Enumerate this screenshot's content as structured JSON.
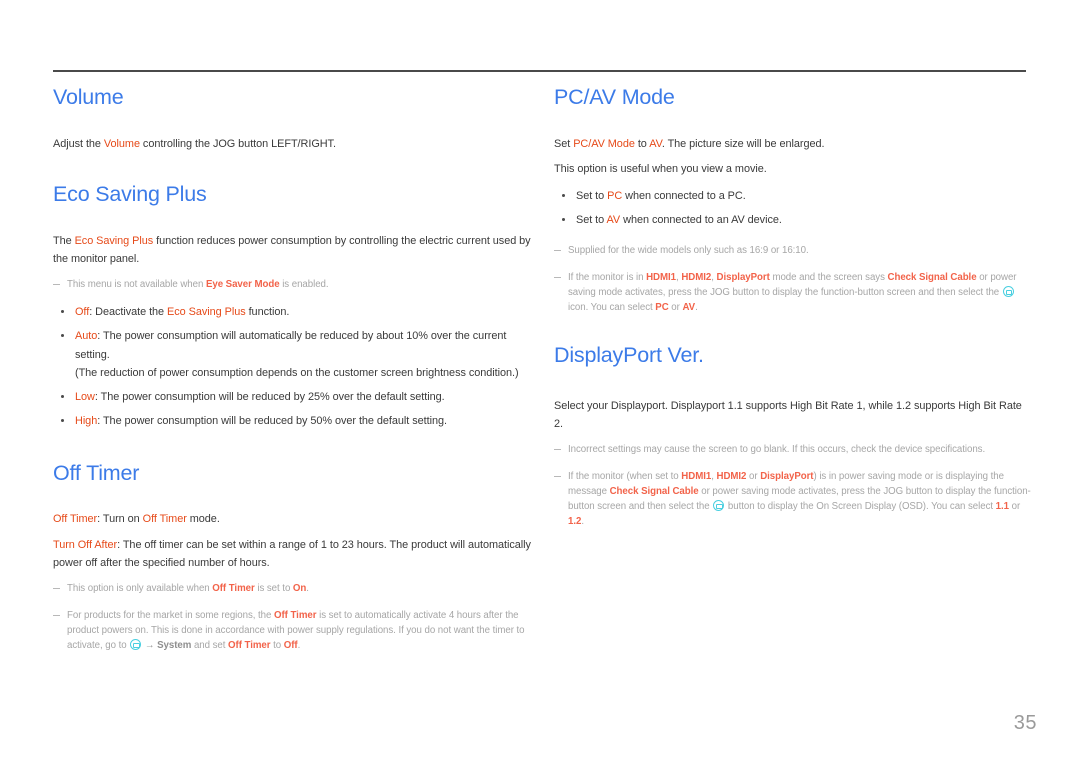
{
  "page": {
    "number": "35",
    "accent_heading_color": "#3C7BE8",
    "accent_highlight_color": "#E64A19",
    "note_color": "#a6a6a6",
    "icon_color": "#49CFE0",
    "rule_color": "#4a4a4a"
  },
  "left_column": {
    "sections": [
      {
        "title": "Volume",
        "paragraphs": [
          {
            "parts": [
              {
                "t": "Adjust the ",
                "s": "plain"
              },
              {
                "t": "Volume",
                "s": "hl"
              },
              {
                "t": " controlling the JOG button LEFT/RIGHT.",
                "s": "plain"
              }
            ]
          }
        ]
      },
      {
        "title": "Eco Saving Plus",
        "paragraphs": [
          {
            "parts": [
              {
                "t": "The ",
                "s": "plain"
              },
              {
                "t": "Eco Saving Plus",
                "s": "hl"
              },
              {
                "t": " function reduces power consumption by controlling the electric current used by the monitor panel.",
                "s": "plain"
              }
            ]
          }
        ],
        "notes": [
          {
            "parts": [
              {
                "t": "This menu is not available when ",
                "s": "plain"
              },
              {
                "t": "Eye Saver Mode",
                "s": "hl-b"
              },
              {
                "t": " is enabled.",
                "s": "plain"
              }
            ]
          }
        ],
        "bullets": [
          {
            "lines": [
              {
                "parts": [
                  {
                    "t": "Off",
                    "s": "hl"
                  },
                  {
                    "t": ": Deactivate the ",
                    "s": "plain"
                  },
                  {
                    "t": "Eco Saving Plus",
                    "s": "hl"
                  },
                  {
                    "t": " function.",
                    "s": "plain"
                  }
                ]
              }
            ]
          },
          {
            "lines": [
              {
                "parts": [
                  {
                    "t": "Auto",
                    "s": "hl"
                  },
                  {
                    "t": ": The power consumption will automatically be reduced by about 10% over the current setting.",
                    "s": "plain"
                  }
                ]
              },
              {
                "parts": [
                  {
                    "t": "(The reduction of power consumption depends on the customer screen brightness condition.)",
                    "s": "plain"
                  }
                ]
              }
            ]
          },
          {
            "lines": [
              {
                "parts": [
                  {
                    "t": "Low",
                    "s": "hl"
                  },
                  {
                    "t": ": The power consumption will be reduced by 25% over the default setting.",
                    "s": "plain"
                  }
                ]
              }
            ]
          },
          {
            "lines": [
              {
                "parts": [
                  {
                    "t": "High",
                    "s": "hl"
                  },
                  {
                    "t": ": The power consumption will be reduced by 50% over the default setting.",
                    "s": "plain"
                  }
                ]
              }
            ]
          }
        ]
      },
      {
        "title": "Off Timer",
        "paragraphs": [
          {
            "parts": [
              {
                "t": "Off Timer",
                "s": "hl"
              },
              {
                "t": ": Turn on ",
                "s": "plain"
              },
              {
                "t": "Off Timer",
                "s": "hl"
              },
              {
                "t": " mode.",
                "s": "plain"
              }
            ]
          },
          {
            "parts": [
              {
                "t": "Turn Off After",
                "s": "hl"
              },
              {
                "t": ": The off timer can be set within a range of 1 to 23 hours. The product will automatically power off after the specified number of hours.",
                "s": "plain"
              }
            ]
          }
        ],
        "notes": [
          {
            "parts": [
              {
                "t": "This option is only available when ",
                "s": "plain"
              },
              {
                "t": "Off Timer",
                "s": "hl-b"
              },
              {
                "t": " is set to ",
                "s": "plain"
              },
              {
                "t": "On",
                "s": "hl-b"
              },
              {
                "t": ".",
                "s": "plain"
              }
            ]
          },
          {
            "parts": [
              {
                "t": "For products for the market in some regions, the ",
                "s": "plain"
              },
              {
                "t": "Off Timer",
                "s": "hl-b"
              },
              {
                "t": " is set to automatically activate 4 hours after the product powers on. This is done in accordance with power supply regulations. If you do not want the timer to activate, go to ",
                "s": "plain"
              },
              {
                "t": "",
                "s": "jog-icon"
              },
              {
                "t": " → ",
                "s": "arrow"
              },
              {
                "t": "System",
                "s": "bold"
              },
              {
                "t": " and set ",
                "s": "plain"
              },
              {
                "t": "Off Timer",
                "s": "hl-b"
              },
              {
                "t": " to ",
                "s": "plain"
              },
              {
                "t": "Off",
                "s": "hl-b"
              },
              {
                "t": ".",
                "s": "plain"
              }
            ]
          }
        ]
      }
    ]
  },
  "right_column": {
    "sections": [
      {
        "title": "PC/AV Mode",
        "paragraphs": [
          {
            "parts": [
              {
                "t": "Set ",
                "s": "plain"
              },
              {
                "t": "PC/AV Mode",
                "s": "hl"
              },
              {
                "t": " to ",
                "s": "plain"
              },
              {
                "t": "AV",
                "s": "hl"
              },
              {
                "t": ". The picture size will be enlarged.",
                "s": "plain"
              }
            ]
          },
          {
            "parts": [
              {
                "t": "This option is useful when you view a movie.",
                "s": "plain"
              }
            ]
          }
        ],
        "bullets": [
          {
            "lines": [
              {
                "parts": [
                  {
                    "t": "Set to ",
                    "s": "plain"
                  },
                  {
                    "t": "PC",
                    "s": "hl"
                  },
                  {
                    "t": " when connected to a PC.",
                    "s": "plain"
                  }
                ]
              }
            ]
          },
          {
            "lines": [
              {
                "parts": [
                  {
                    "t": "Set to ",
                    "s": "plain"
                  },
                  {
                    "t": "AV",
                    "s": "hl"
                  },
                  {
                    "t": " when connected to an AV device.",
                    "s": "plain"
                  }
                ]
              }
            ]
          }
        ],
        "notes": [
          {
            "parts": [
              {
                "t": "Supplied for the wide models only such as 16:9 or 16:10.",
                "s": "plain"
              }
            ]
          },
          {
            "parts": [
              {
                "t": "If the monitor is in ",
                "s": "plain"
              },
              {
                "t": "HDMI1",
                "s": "hl-b"
              },
              {
                "t": ", ",
                "s": "plain"
              },
              {
                "t": "HDMI2",
                "s": "hl-b"
              },
              {
                "t": ", ",
                "s": "plain"
              },
              {
                "t": "DisplayPort",
                "s": "hl-b"
              },
              {
                "t": " mode and the screen says ",
                "s": "plain"
              },
              {
                "t": "Check Signal Cable",
                "s": "hl-b"
              },
              {
                "t": " or power saving mode activates, press the JOG button to display the function-button screen and then select the ",
                "s": "plain"
              },
              {
                "t": "",
                "s": "jog-icon"
              },
              {
                "t": " icon. You can select ",
                "s": "plain"
              },
              {
                "t": "PC",
                "s": "hl-b"
              },
              {
                "t": " or ",
                "s": "plain"
              },
              {
                "t": "AV",
                "s": "hl-b"
              },
              {
                "t": ".",
                "s": "plain"
              }
            ]
          }
        ]
      },
      {
        "title": "DisplayPort Ver.",
        "paragraphs": [
          {
            "parts": [
              {
                "t": "Select your Displayport. Displayport 1.1 supports High Bit Rate 1, while 1.2 supports High Bit Rate 2.",
                "s": "plain"
              }
            ]
          }
        ],
        "notes": [
          {
            "parts": [
              {
                "t": "Incorrect settings may cause the screen to go blank. If this occurs, check the device specifications.",
                "s": "plain"
              }
            ]
          },
          {
            "parts": [
              {
                "t": "If the monitor (when set to ",
                "s": "plain"
              },
              {
                "t": "HDMI1",
                "s": "hl-b"
              },
              {
                "t": ", ",
                "s": "plain"
              },
              {
                "t": "HDMI2",
                "s": "hl-b"
              },
              {
                "t": " or ",
                "s": "plain"
              },
              {
                "t": "DisplayPort",
                "s": "hl-b"
              },
              {
                "t": ") is in power saving mode or is displaying the message ",
                "s": "plain"
              },
              {
                "t": "Check Signal Cable",
                "s": "hl-b"
              },
              {
                "t": " or power saving mode activates, press the JOG button to display the function-button screen and then select the ",
                "s": "plain"
              },
              {
                "t": "",
                "s": "jog-icon"
              },
              {
                "t": " button to display the On Screen Display (OSD). You can select ",
                "s": "plain"
              },
              {
                "t": "1.1",
                "s": "hl-b"
              },
              {
                "t": " or ",
                "s": "plain"
              },
              {
                "t": "1.2",
                "s": "hl-b"
              },
              {
                "t": ".",
                "s": "plain"
              }
            ]
          }
        ]
      }
    ]
  }
}
